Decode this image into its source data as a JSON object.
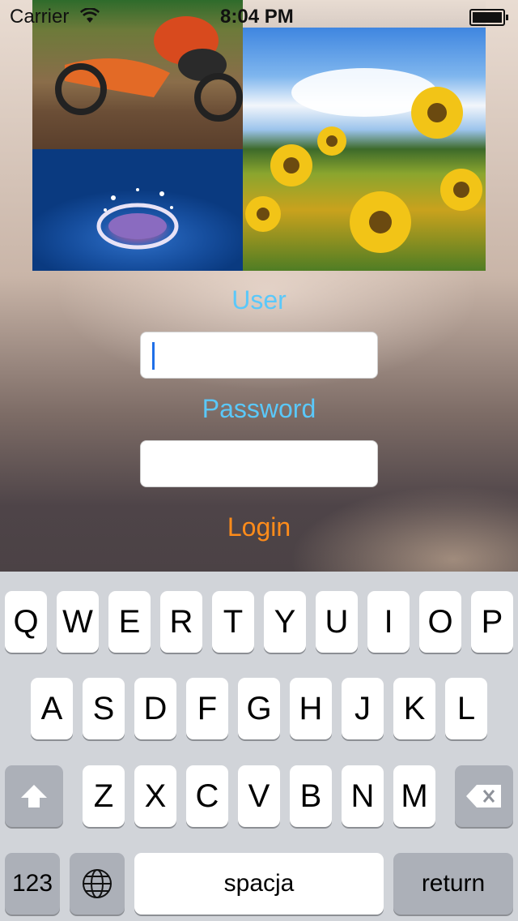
{
  "status_bar": {
    "carrier": "Carrier",
    "time": "8:04 PM"
  },
  "form": {
    "user_label": "User",
    "password_label": "Password",
    "login_label": "Login",
    "user_value": "",
    "password_value": ""
  },
  "keyboard": {
    "row1": [
      "Q",
      "W",
      "E",
      "R",
      "T",
      "Y",
      "U",
      "I",
      "O",
      "P"
    ],
    "row2": [
      "A",
      "S",
      "D",
      "F",
      "G",
      "H",
      "J",
      "K",
      "L"
    ],
    "row3": [
      "Z",
      "X",
      "C",
      "V",
      "B",
      "N",
      "M"
    ],
    "numbers_label": "123",
    "space_label": "spacja",
    "return_label": "return"
  },
  "colors": {
    "label_blue": "#5ac8fa",
    "login_orange": "#ff8c1a"
  }
}
